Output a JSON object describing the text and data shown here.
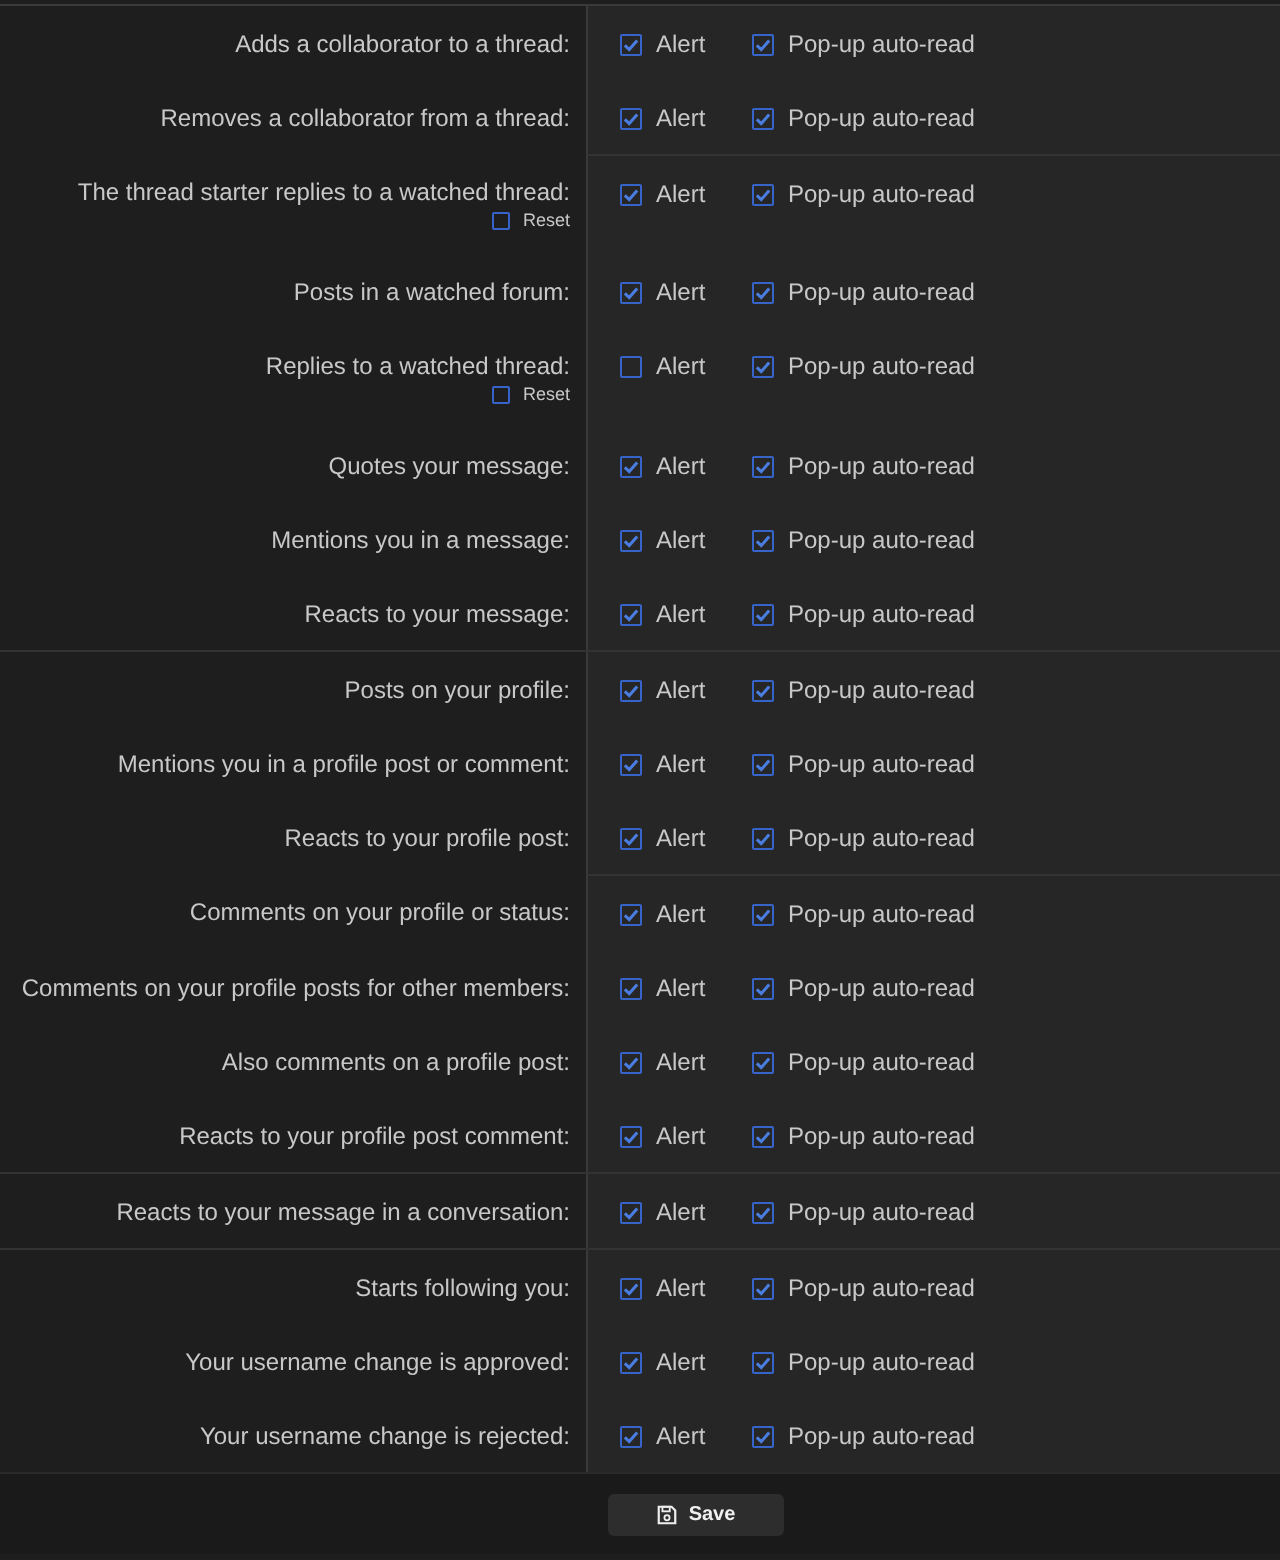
{
  "sections": [
    {
      "groups": [
        {
          "rows": [
            {
              "label": "Adds a collaborator to a thread:",
              "alert": {
                "label": "Alert",
                "checked": true
              },
              "popup": {
                "label": "Pop-up auto-read",
                "checked": true
              }
            },
            {
              "label": "Removes a collaborator from a thread:",
              "alert": {
                "label": "Alert",
                "checked": true
              },
              "popup": {
                "label": "Pop-up auto-read",
                "checked": true
              }
            }
          ]
        },
        {
          "rows": [
            {
              "label": "The thread starter replies to a watched thread:",
              "reset": {
                "label": "Reset",
                "checked": false
              },
              "alert": {
                "label": "Alert",
                "checked": true
              },
              "popup": {
                "label": "Pop-up auto-read",
                "checked": true
              }
            },
            {
              "label": "Posts in a watched forum:",
              "alert": {
                "label": "Alert",
                "checked": true
              },
              "popup": {
                "label": "Pop-up auto-read",
                "checked": true
              }
            },
            {
              "label": "Replies to a watched thread:",
              "reset": {
                "label": "Reset",
                "checked": false
              },
              "alert": {
                "label": "Alert",
                "checked": false
              },
              "popup": {
                "label": "Pop-up auto-read",
                "checked": true
              }
            },
            {
              "label": "Quotes your message:",
              "alert": {
                "label": "Alert",
                "checked": true
              },
              "popup": {
                "label": "Pop-up auto-read",
                "checked": true
              }
            },
            {
              "label": "Mentions you in a message:",
              "alert": {
                "label": "Alert",
                "checked": true
              },
              "popup": {
                "label": "Pop-up auto-read",
                "checked": true
              }
            },
            {
              "label": "Reacts to your message:",
              "alert": {
                "label": "Alert",
                "checked": true
              },
              "popup": {
                "label": "Pop-up auto-read",
                "checked": true
              }
            }
          ]
        }
      ]
    },
    {
      "groups": [
        {
          "rows": [
            {
              "label": "Posts on your profile:",
              "alert": {
                "label": "Alert",
                "checked": true
              },
              "popup": {
                "label": "Pop-up auto-read",
                "checked": true
              }
            },
            {
              "label": "Mentions you in a profile post or comment:",
              "alert": {
                "label": "Alert",
                "checked": true
              },
              "popup": {
                "label": "Pop-up auto-read",
                "checked": true
              }
            },
            {
              "label": "Reacts to your profile post:",
              "alert": {
                "label": "Alert",
                "checked": true
              },
              "popup": {
                "label": "Pop-up auto-read",
                "checked": true
              }
            }
          ]
        },
        {
          "rows": [
            {
              "label": "Comments on your profile or status:",
              "alert": {
                "label": "Alert",
                "checked": true
              },
              "popup": {
                "label": "Pop-up auto-read",
                "checked": true
              }
            },
            {
              "label": "Comments on your profile posts for other members:",
              "alert": {
                "label": "Alert",
                "checked": true
              },
              "popup": {
                "label": "Pop-up auto-read",
                "checked": true
              }
            },
            {
              "label": "Also comments on a profile post:",
              "alert": {
                "label": "Alert",
                "checked": true
              },
              "popup": {
                "label": "Pop-up auto-read",
                "checked": true
              }
            },
            {
              "label": "Reacts to your profile post comment:",
              "alert": {
                "label": "Alert",
                "checked": true
              },
              "popup": {
                "label": "Pop-up auto-read",
                "checked": true
              }
            }
          ]
        }
      ]
    },
    {
      "groups": [
        {
          "rows": [
            {
              "label": "Reacts to your message in a conversation:",
              "alert": {
                "label": "Alert",
                "checked": true
              },
              "popup": {
                "label": "Pop-up auto-read",
                "checked": true
              }
            }
          ]
        }
      ]
    },
    {
      "groups": [
        {
          "rows": [
            {
              "label": "Starts following you:",
              "alert": {
                "label": "Alert",
                "checked": true
              },
              "popup": {
                "label": "Pop-up auto-read",
                "checked": true
              }
            },
            {
              "label": "Your username change is approved:",
              "alert": {
                "label": "Alert",
                "checked": true
              },
              "popup": {
                "label": "Pop-up auto-read",
                "checked": true
              }
            },
            {
              "label": "Your username change is rejected:",
              "alert": {
                "label": "Alert",
                "checked": true
              },
              "popup": {
                "label": "Pop-up auto-read",
                "checked": true
              }
            }
          ]
        }
      ]
    }
  ],
  "save_button": {
    "label": "Save"
  }
}
